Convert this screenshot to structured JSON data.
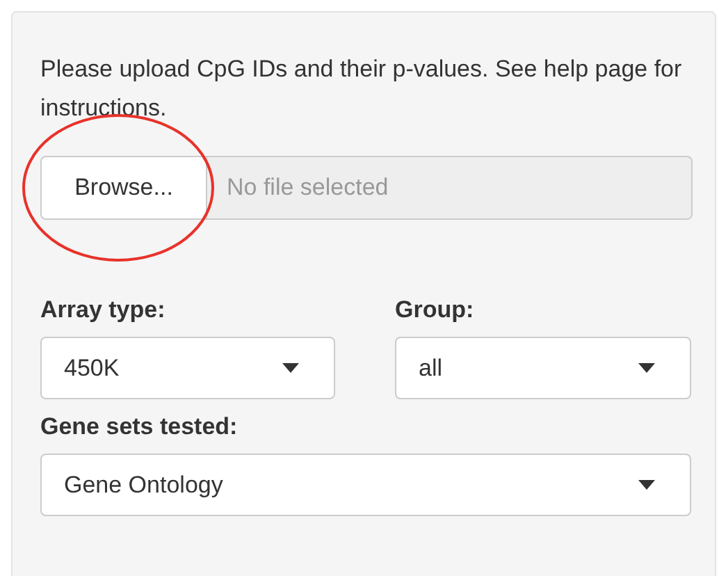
{
  "instructions": "Please upload CpG IDs and their p-values. See help page for instructions.",
  "upload": {
    "button": "Browse...",
    "placeholder": "No file selected"
  },
  "selects": [
    {
      "label": "Array type:",
      "value": "450K"
    },
    {
      "label": "Group:",
      "value": "all"
    },
    {
      "label": "Gene sets tested:",
      "value": "Gene Ontology"
    }
  ]
}
